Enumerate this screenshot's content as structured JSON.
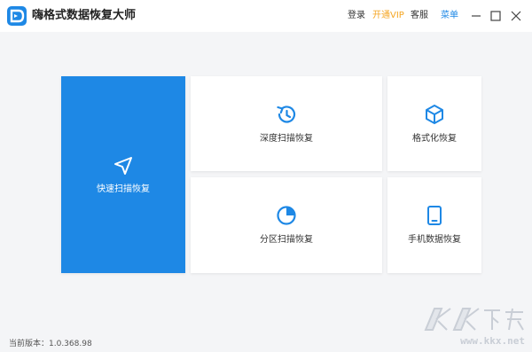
{
  "app": {
    "title": "嗨格式数据恢复大师",
    "brand_color": "#1e88e5"
  },
  "titlebar": {
    "login": "登录",
    "vip": "开通VIP",
    "service": "客服",
    "menu": "菜单",
    "vip_color": "#f5a623",
    "menu_color": "#1e88e5"
  },
  "tiles": {
    "quick_scan": {
      "label": "快速扫描恢复",
      "icon": "navigation-arrow-icon"
    },
    "deep_scan": {
      "label": "深度扫描恢复",
      "icon": "history-clock-icon"
    },
    "format_recovery": {
      "label": "格式化恢复",
      "icon": "cube-icon"
    },
    "partition_scan": {
      "label": "分区扫描恢复",
      "icon": "pie-chart-icon"
    },
    "phone_recovery": {
      "label": "手机数据恢复",
      "icon": "tablet-icon"
    }
  },
  "footer": {
    "version": "当前版本：1.0.368.98"
  },
  "watermark": {
    "text": "www.kkx.net",
    "logo": "KK下载"
  }
}
